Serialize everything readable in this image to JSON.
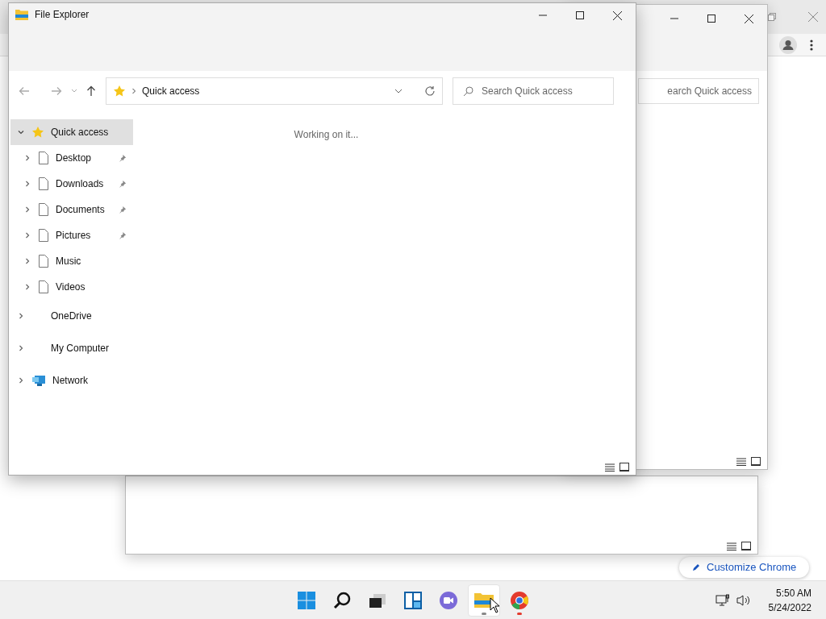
{
  "chrome_window": {
    "customize_button": "Customize Chrome"
  },
  "back_explorer": {
    "search": {
      "placeholder": "earch Quick access"
    }
  },
  "explorer": {
    "title": "File Explorer",
    "address": {
      "path": "Quick access"
    },
    "search": {
      "placeholder": "Search Quick access"
    },
    "status": "Working on it...",
    "sidebar": [
      {
        "label": "Quick access",
        "kind": "star",
        "expanded": true,
        "selected": true,
        "children": [
          {
            "label": "Desktop",
            "kind": "file",
            "pinned": true,
            "selected": false
          },
          {
            "label": "Downloads",
            "kind": "file",
            "pinned": true,
            "selected": false
          },
          {
            "label": "Documents",
            "kind": "file",
            "pinned": true,
            "selected": false
          },
          {
            "label": "Pictures",
            "kind": "file",
            "pinned": true,
            "selected": false
          },
          {
            "label": "Music",
            "kind": "file",
            "pinned": false,
            "selected": false
          },
          {
            "label": "Videos",
            "kind": "file",
            "pinned": false,
            "selected": false
          }
        ]
      },
      {
        "label": "OneDrive",
        "kind": "none",
        "expanded": false,
        "selected": false
      },
      {
        "label": "My Computer",
        "kind": "none",
        "expanded": false,
        "selected": false
      },
      {
        "label": "Network",
        "kind": "network",
        "expanded": false,
        "selected": false
      }
    ]
  },
  "taskbar": {
    "apps": [
      {
        "kind": "start",
        "running": false,
        "focused": false,
        "attention": false
      },
      {
        "kind": "search",
        "running": false,
        "focused": false,
        "attention": false
      },
      {
        "kind": "taskview",
        "running": false,
        "focused": false,
        "attention": false
      },
      {
        "kind": "widgets",
        "running": false,
        "focused": false,
        "attention": false
      },
      {
        "kind": "chat",
        "running": false,
        "focused": false,
        "attention": false
      },
      {
        "kind": "explorer",
        "running": true,
        "focused": true,
        "attention": false
      },
      {
        "kind": "chrome",
        "running": true,
        "focused": false,
        "attention": true
      }
    ],
    "time": "5:50 AM",
    "date": "5/24/2022"
  }
}
